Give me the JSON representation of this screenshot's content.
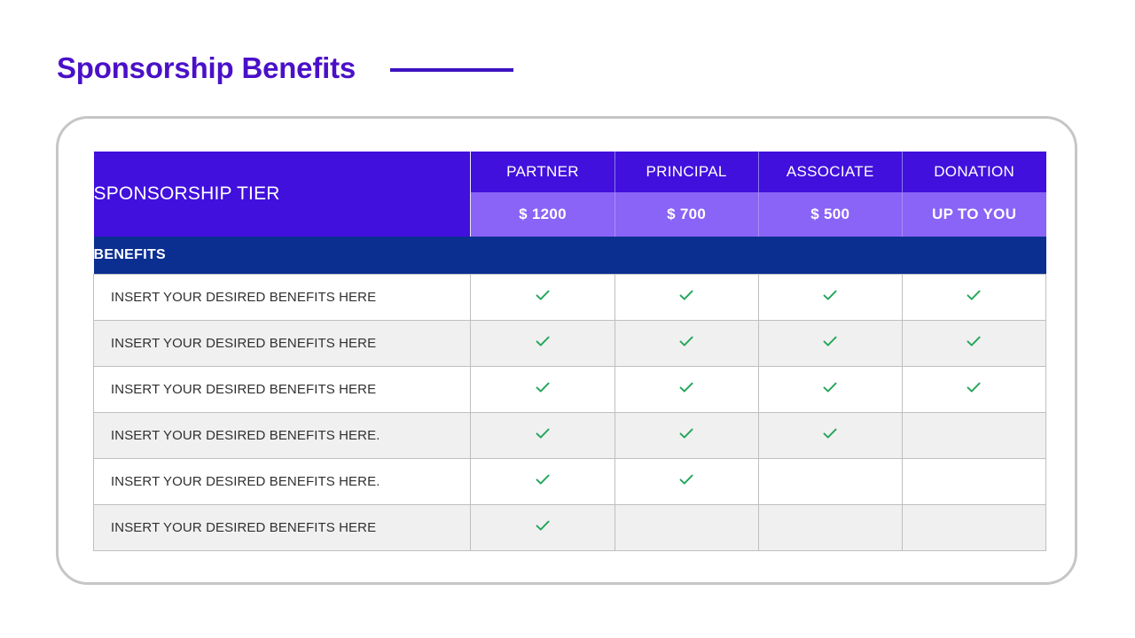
{
  "page": {
    "title": "Sponsorship Benefits",
    "accent_color": "#4a10c8",
    "rule_color": "#3c12c0",
    "header_color": "#4110dd",
    "price_row_color": "#8a63f7",
    "benefits_band_color": "#0b2f91",
    "check_color": "#22a65a"
  },
  "table": {
    "tier_label": "SPONSORSHIP TIER",
    "benefits_band_label": "BENEFITS",
    "tiers": [
      {
        "name": "PARTNER",
        "price": "$ 1200"
      },
      {
        "name": "PRINCIPAL",
        "price": "$ 700"
      },
      {
        "name": "ASSOCIATE",
        "price": "$ 500"
      },
      {
        "name": "DONATION",
        "price": "UP TO YOU"
      }
    ],
    "rows": [
      {
        "label": "INSERT YOUR DESIRED BENEFITS HERE",
        "checks": [
          true,
          true,
          true,
          true
        ]
      },
      {
        "label": "INSERT YOUR DESIRED BENEFITS HERE",
        "checks": [
          true,
          true,
          true,
          true
        ]
      },
      {
        "label": "INSERT YOUR DESIRED BENEFITS HERE",
        "checks": [
          true,
          true,
          true,
          true
        ]
      },
      {
        "label": "INSERT YOUR DESIRED BENEFITS HERE.",
        "checks": [
          true,
          true,
          true,
          false
        ]
      },
      {
        "label": "INSERT YOUR DESIRED BENEFITS HERE.",
        "checks": [
          true,
          true,
          false,
          false
        ]
      },
      {
        "label": "INSERT YOUR DESIRED BENEFITS HERE",
        "checks": [
          true,
          false,
          false,
          false
        ]
      }
    ]
  }
}
